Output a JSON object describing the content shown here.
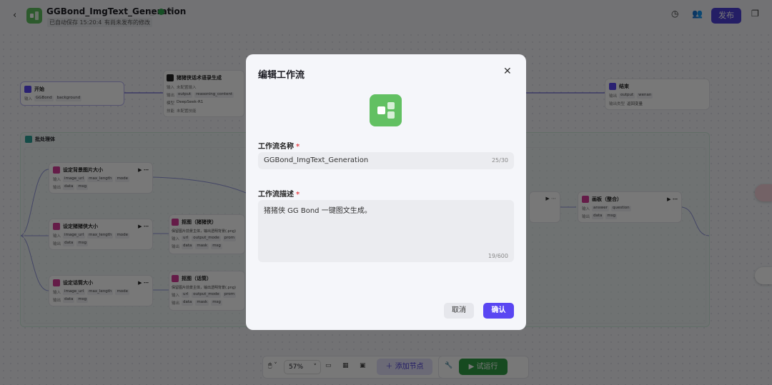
{
  "header": {
    "back": "‹",
    "title": "GGBond_ImgText_Generation",
    "saved": "已自动保存 15:20:42",
    "unpublished": "有尚未发布的修改",
    "publish": "发布"
  },
  "nodes": {
    "start": {
      "title": "开始",
      "in_label": "输入",
      "params": [
        "GGBond",
        "background"
      ]
    },
    "llm": {
      "title": "猪猪侠话术语录生成",
      "in_label": "输入",
      "in_val": "未配置输入",
      "out_label": "输出",
      "outs": [
        "output",
        "reasoning_content"
      ],
      "model_label": "模型",
      "model": "DeepSeek-R1",
      "skill_label": "技能",
      "skill": "未配置技能"
    },
    "end": {
      "title": "结束",
      "out_label": "输出",
      "outs": [
        "output",
        "wenan"
      ],
      "type_label": "输出类型",
      "type": "返回变量"
    },
    "batch": {
      "title": "批处理体"
    },
    "resize_bg": {
      "title": "设定背景图片大小",
      "in_label": "输入",
      "ins": [
        "image_url",
        "max_length",
        "mode"
      ],
      "out_label": "输出",
      "outs": [
        "data",
        "msg"
      ]
    },
    "resize_pig": {
      "title": "设定猪猪侠大小",
      "in_label": "输入",
      "ins": [
        "image_url",
        "max_length",
        "mode"
      ],
      "out_label": "输出",
      "outs": [
        "data",
        "msg"
      ]
    },
    "resize_mic": {
      "title": "设定话筒大小",
      "in_label": "输入",
      "ins": [
        "image_url",
        "max_length",
        "mode"
      ],
      "out_label": "输出",
      "outs": [
        "data",
        "msg"
      ]
    },
    "cut_pig": {
      "title": "抠图（猪猪侠）",
      "desc": "保留图片前景主体，输出透明背景(.png)",
      "in_label": "输入",
      "ins": [
        "url",
        "output_mode",
        "prom"
      ],
      "out_label": "输出",
      "outs": [
        "data",
        "mask",
        "msg"
      ]
    },
    "cut_mic": {
      "title": "抠图（话筒）",
      "desc": "保留图片前景主体，输出透明背景(.png)",
      "in_label": "输入",
      "ins": [
        "url",
        "output_mode",
        "prom"
      ],
      "out_label": "输出",
      "outs": [
        "data",
        "mask",
        "msg"
      ]
    },
    "board": {
      "title": "画板（整合）",
      "in_label": "输入",
      "ins": [
        "answer",
        "question"
      ],
      "out_label": "输出",
      "outs": [
        "data",
        "msg"
      ]
    }
  },
  "toolbar": {
    "zoom": "57%",
    "add_node": "添加节点",
    "run": "试运行"
  },
  "modal": {
    "title": "编辑工作流",
    "name_label": "工作流名称",
    "name_value": "GGBond_ImgText_Generation",
    "name_count": "25/30",
    "desc_label": "工作流描述",
    "desc_value": "猪猪侠 GG Bond 一键图文生成。",
    "desc_count": "19/600",
    "cancel": "取消",
    "confirm": "确认"
  },
  "colors": {
    "accent": "#5a46f2",
    "publish": "#4d3fd6",
    "run": "#2f9e44",
    "icon_green": "#62c062"
  }
}
